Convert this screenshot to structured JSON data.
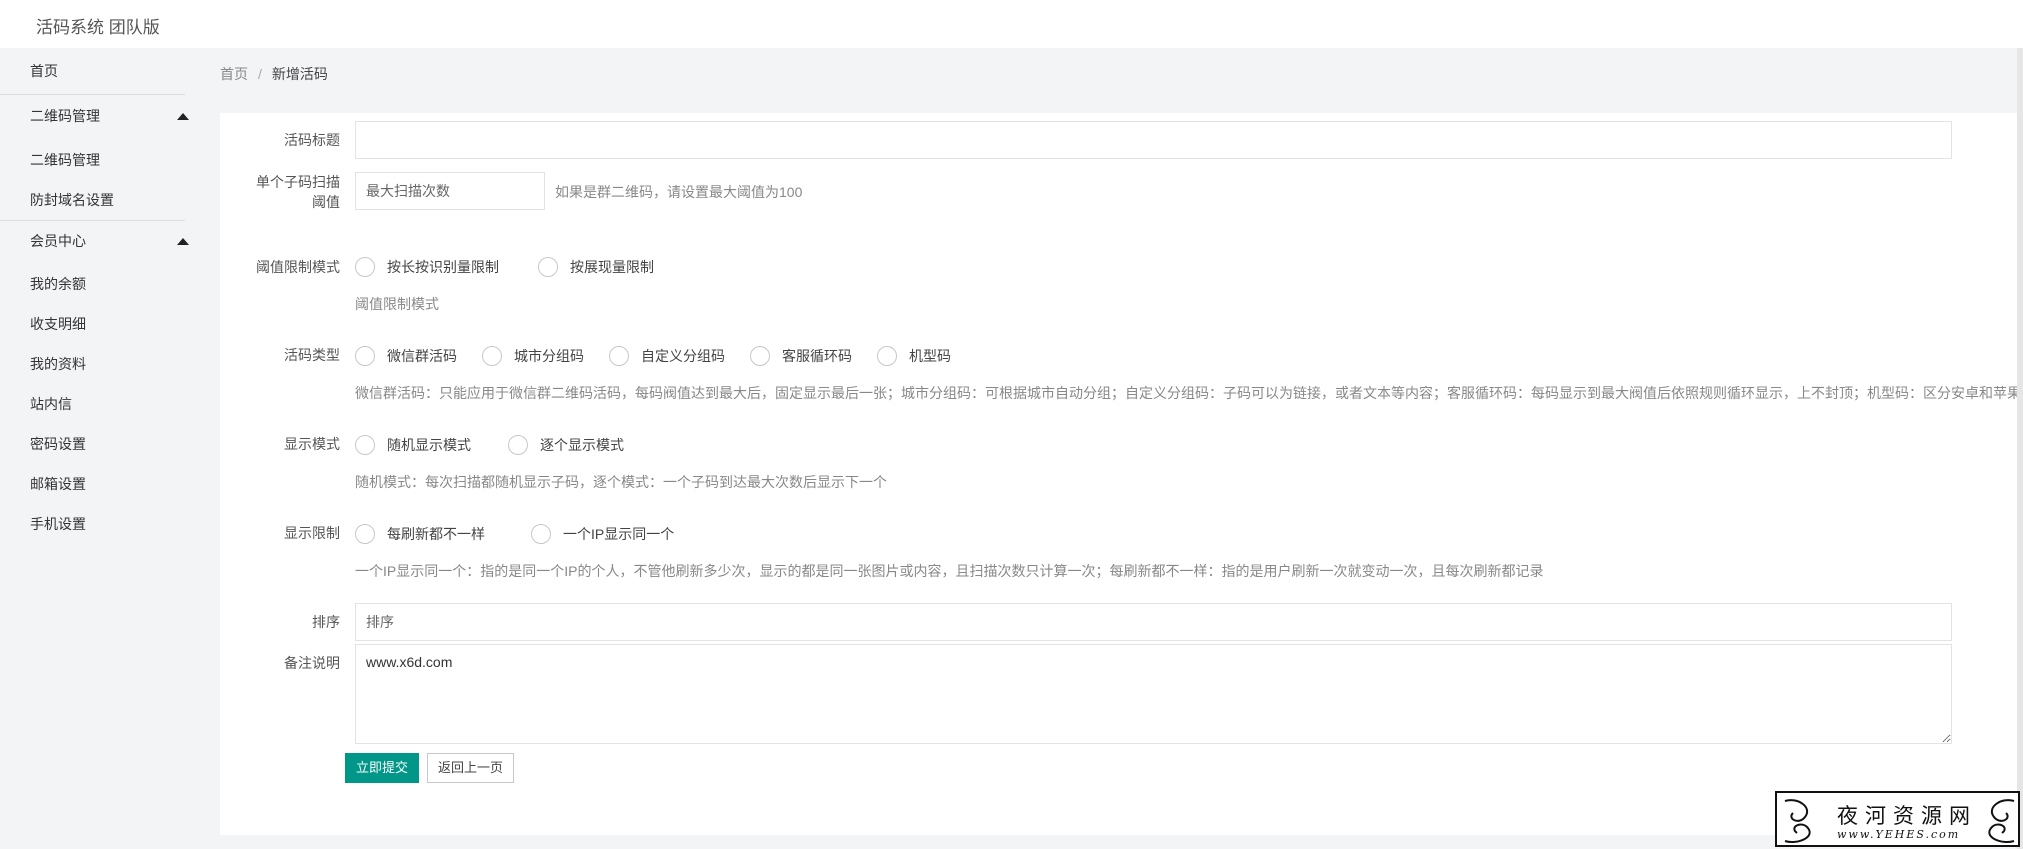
{
  "header": {
    "title": "活码系统 团队版"
  },
  "sidebar": {
    "home": "首页",
    "groups": [
      {
        "label": "二维码管理",
        "items": [
          "二维码管理",
          "防封域名设置"
        ]
      },
      {
        "label": "会员中心",
        "items": [
          "我的余额",
          "收支明细",
          "我的资料",
          "站内信",
          "密码设置",
          "邮箱设置",
          "手机设置"
        ]
      }
    ]
  },
  "breadcrumb": {
    "home": "首页",
    "separator": "/",
    "current": "新增活码"
  },
  "form": {
    "title_field": {
      "label": "活码标题",
      "value": ""
    },
    "threshold": {
      "label_line1": "单个子码扫描",
      "label_line2": "阈值",
      "placeholder": "最大扫描次数",
      "hint": "如果是群二维码，请设置最大阈值为100"
    },
    "threshold_mode": {
      "label": "阈值限制模式",
      "options": [
        "按长按识别量限制",
        "按展现量限制"
      ],
      "help": "阈值限制模式"
    },
    "code_type": {
      "label": "活码类型",
      "options": [
        "微信群活码",
        "城市分组码",
        "自定义分组码",
        "客服循环码",
        "机型码"
      ],
      "help": "微信群活码：只能应用于微信群二维码活码，每码阀值达到最大后，固定显示最后一张；城市分组码：可根据城市自动分组；自定义分组码：子码可以为链接，或者文本等内容；客服循环码：每码显示到最大阀值后依照规则循环显示，上不封顶；机型码：区分安卓和苹果"
    },
    "display_mode": {
      "label": "显示模式",
      "options": [
        "随机显示模式",
        "逐个显示模式"
      ],
      "help": "随机模式：每次扫描都随机显示子码，逐个模式：一个子码到达最大次数后显示下一个"
    },
    "display_limit": {
      "label": "显示限制",
      "options": [
        "每刷新都不一样",
        "一个IP显示同一个"
      ],
      "help": "一个IP显示同一个：指的是同一个IP的个人，不管他刷新多少次，显示的都是同一张图片或内容，且扫描次数只计算一次；每刷新都不一样：指的是用户刷新一次就变动一次，且每次刷新都记录"
    },
    "sort": {
      "label": "排序",
      "placeholder": "排序"
    },
    "remark": {
      "label": "备注说明",
      "value": "www.x6d.com"
    },
    "submit_label": "立即提交",
    "back_label": "返回上一页"
  },
  "watermark": {
    "cn": "夜河资源网",
    "en": "www.YEHES.com"
  },
  "colors": {
    "primary": "#009688",
    "sidebar_bg": "#f3f4f6",
    "card_bg": "#ffffff"
  }
}
